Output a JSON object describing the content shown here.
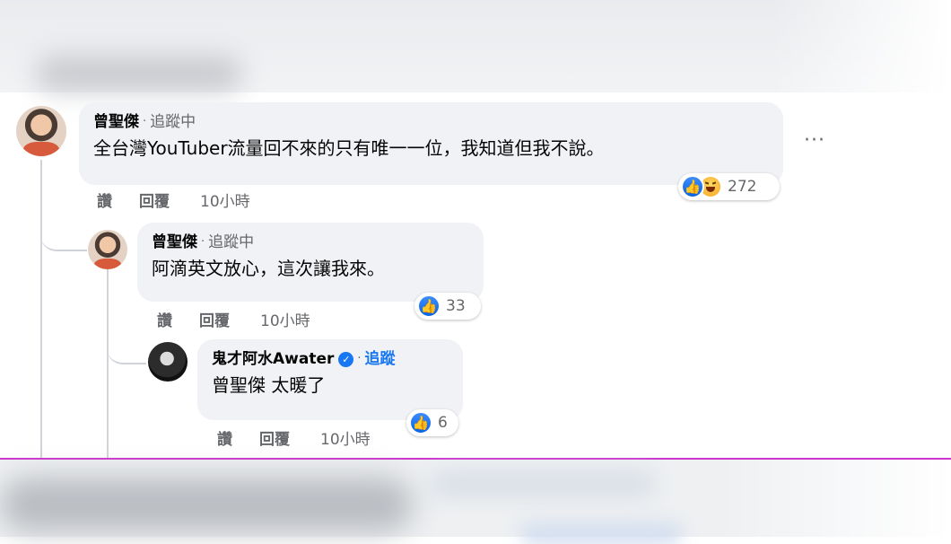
{
  "comments": [
    {
      "author": "曾聖傑",
      "follow": "追蹤中",
      "text": "全台灣YouTuber流量回不來的只有唯一一位，我知道但我不說。",
      "reaction_count": "272",
      "reactions": [
        "like-icon",
        "haha-icon"
      ],
      "actions": {
        "like": "讚",
        "reply": "回覆",
        "time": "10小時"
      },
      "more": "···"
    },
    {
      "author": "曾聖傑",
      "follow": "追蹤中",
      "text": "阿滴英文放心，這次讓我來。",
      "reaction_count": "33",
      "reactions": [
        "like-icon"
      ],
      "actions": {
        "like": "讚",
        "reply": "回覆",
        "time": "10小時"
      }
    },
    {
      "author": "鬼才阿水Awater",
      "verified": true,
      "follow": "追蹤",
      "text": "曾聖傑 太暖了",
      "reaction_count": "6",
      "reactions": [
        "like-icon"
      ],
      "actions": {
        "like": "讚",
        "reply": "回覆",
        "time": "10小時"
      }
    }
  ],
  "colors": {
    "bubble": "#f0f2f5",
    "link": "#1877f2",
    "meta": "#65676b",
    "divider": "#cc33cc"
  }
}
